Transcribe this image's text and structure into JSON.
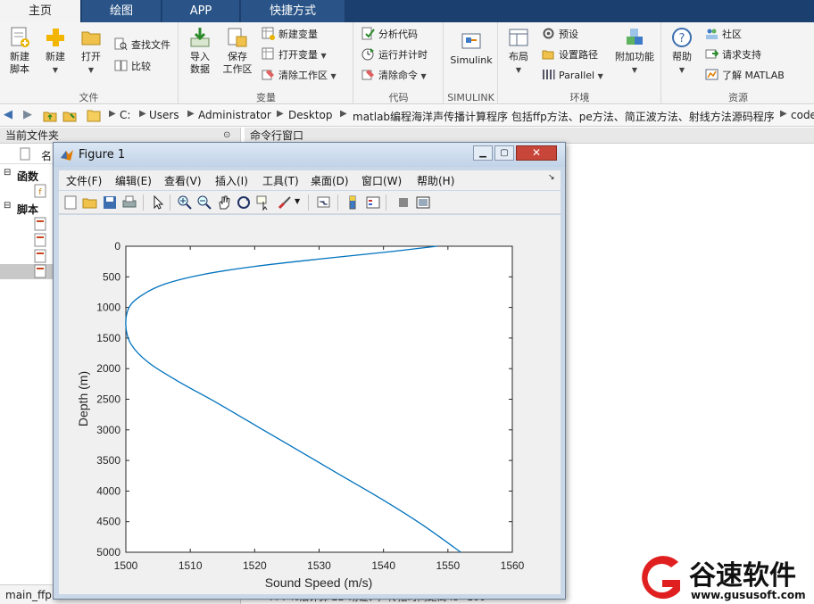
{
  "tabs": [
    "主页",
    "绘图",
    "APP",
    "快捷方式"
  ],
  "ribbon": {
    "file": {
      "label": "文件",
      "new_script": "新建\n脚本",
      "new": "新建",
      "open": "打开",
      "find_files": "查找文件",
      "compare": "比较"
    },
    "variable": {
      "label": "变量",
      "import": "导入\n数据",
      "save_ws": "保存\n工作区",
      "new_var": "新建变量",
      "open_var": "打开变量",
      "clear_ws": "清除工作区"
    },
    "code": {
      "label": "代码",
      "analyze": "分析代码",
      "run_time": "运行并计时",
      "clear_cmd": "清除命令"
    },
    "simulink": {
      "label": "SIMULINK",
      "btn": "Simulink"
    },
    "env": {
      "label": "环境",
      "layout": "布局",
      "prefs": "预设",
      "set_path": "设置路径",
      "parallel": "Parallel",
      "addons": "附加功能"
    },
    "resources": {
      "label": "资源",
      "help": "帮助",
      "community": "社区",
      "support": "请求支持",
      "learn": "了解 MATLAB"
    }
  },
  "address": {
    "crumbs": [
      "C:",
      "Users",
      "Administrator",
      "Desktop",
      "matlab编程海洋声传播计算程序 包括ffp方法、pe方法、简正波方法、射线方法源码程序",
      "code"
    ]
  },
  "left_panel": {
    "header": "当前文件夹",
    "col_name": "名",
    "section_functions": "函数",
    "section_scripts": "脚本",
    "footer_file": "main_ffp.m"
  },
  "right_panel": {
    "header": "命令行窗口",
    "bottom_text": "FFT %法计算 2D 场证：声传播时间距离 lo=100"
  },
  "figure": {
    "title": "Figure 1",
    "menus": [
      "文件(F)",
      "编辑(E)",
      "查看(V)",
      "插入(I)",
      "工具(T)",
      "桌面(D)",
      "窗口(W)",
      "帮助(H)"
    ]
  },
  "chart_data": {
    "type": "line",
    "xlabel": "Sound Speed (m/s)",
    "ylabel": "Depth (m)",
    "xlim": [
      1500,
      1560
    ],
    "ylim": [
      0,
      5000
    ],
    "y_reversed": true,
    "xticks": [
      1500,
      1510,
      1520,
      1530,
      1540,
      1550,
      1560
    ],
    "yticks": [
      0,
      500,
      1000,
      1500,
      2000,
      2500,
      3000,
      3500,
      4000,
      4500,
      5000
    ],
    "series": [
      {
        "color": "#0072bd",
        "x": [
          1548.3,
          1540.0,
          1530.0,
          1520.0,
          1512.0,
          1506.0,
          1502.5,
          1500.5,
          1500.0,
          1500.8,
          1503.5,
          1508.0,
          1514.0,
          1520.5,
          1527.0,
          1533.5,
          1540.0,
          1546.0,
          1552.0
        ],
        "y": [
          0,
          100,
          210,
          330,
          460,
          620,
          800,
          1000,
          1300,
          1600,
          1900,
          2200,
          2550,
          2950,
          3350,
          3750,
          4150,
          4550,
          5000
        ]
      }
    ]
  },
  "watermark": {
    "brand": "谷速软件",
    "url": "www.gususoft.com"
  }
}
